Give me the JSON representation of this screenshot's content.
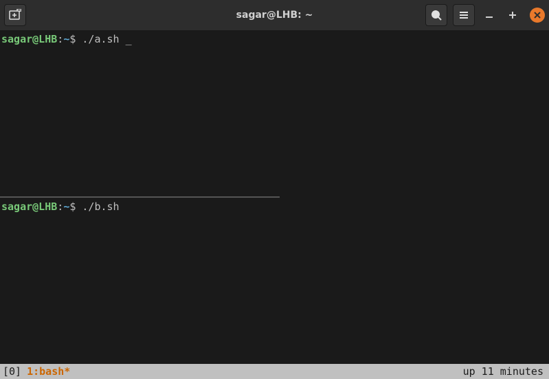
{
  "window": {
    "title": "sagar@LHB: ~"
  },
  "panes": [
    {
      "prompt": {
        "user_host": "sagar@LHB",
        "colon": ":",
        "path": "~",
        "dollar": "$ "
      },
      "command": "./a.sh ",
      "cursor": "_"
    },
    {
      "prompt": {
        "user_host": "sagar@LHB",
        "colon": ":",
        "path": "~",
        "dollar": "$ "
      },
      "command": "./b.sh",
      "cursor": ""
    }
  ],
  "statusbar": {
    "session": "[0]",
    "window": "1:bash*",
    "uptime": "up 11 minutes"
  }
}
